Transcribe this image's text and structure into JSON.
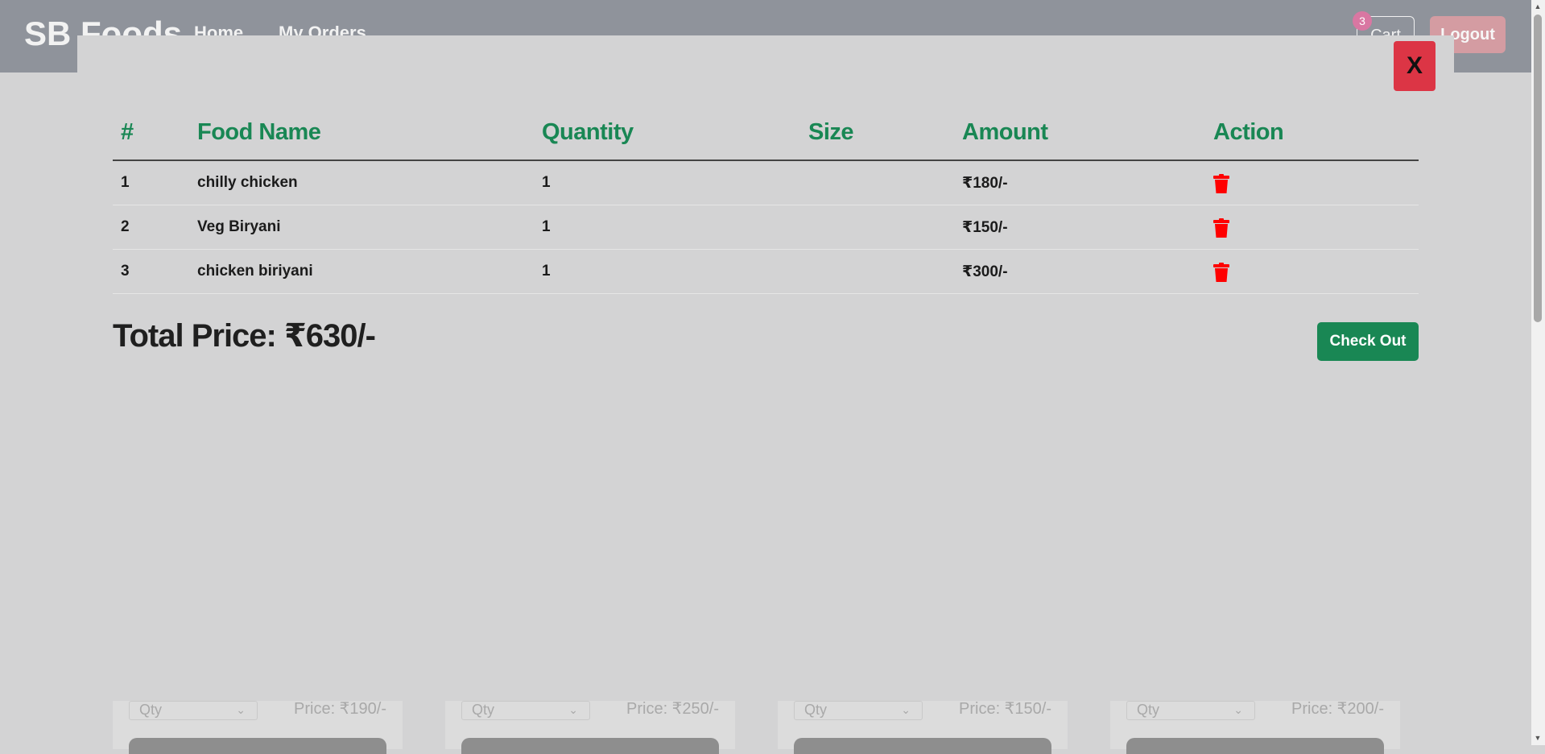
{
  "navbar": {
    "brand": "SB Foods",
    "links": [
      "Home",
      "My Orders"
    ],
    "cart_label": "Cart",
    "cart_count": "3",
    "logout_label": "Logout"
  },
  "modal": {
    "close_label": "X",
    "table": {
      "headers": [
        "#",
        "Food Name",
        "Quantity",
        "Size",
        "Amount",
        "Action"
      ],
      "rows": [
        {
          "index": "1",
          "name": "chilly chicken",
          "quantity": "1",
          "size": "",
          "amount": "₹180/-"
        },
        {
          "index": "2",
          "name": "Veg Biryani",
          "quantity": "1",
          "size": "",
          "amount": "₹150/-"
        },
        {
          "index": "3",
          "name": "chicken biriyani",
          "quantity": "1",
          "size": "",
          "amount": "₹300/-"
        }
      ]
    },
    "total_label": "Total Price: ₹630/-",
    "checkout_label": "Check Out"
  },
  "background_cards": [
    {
      "qty_placeholder": "Qty",
      "price": "Price: ₹190/-"
    },
    {
      "qty_placeholder": "Qty",
      "price": "Price: ₹250/-"
    },
    {
      "qty_placeholder": "Qty",
      "price": "Price: ₹150/-"
    },
    {
      "qty_placeholder": "Qty",
      "price": "Price: ₹200/-"
    }
  ],
  "colors": {
    "accent_green": "#198754",
    "danger_red": "#dc3545",
    "trash_red": "#ff0000"
  },
  "icons": {
    "delete": "trash-icon"
  }
}
